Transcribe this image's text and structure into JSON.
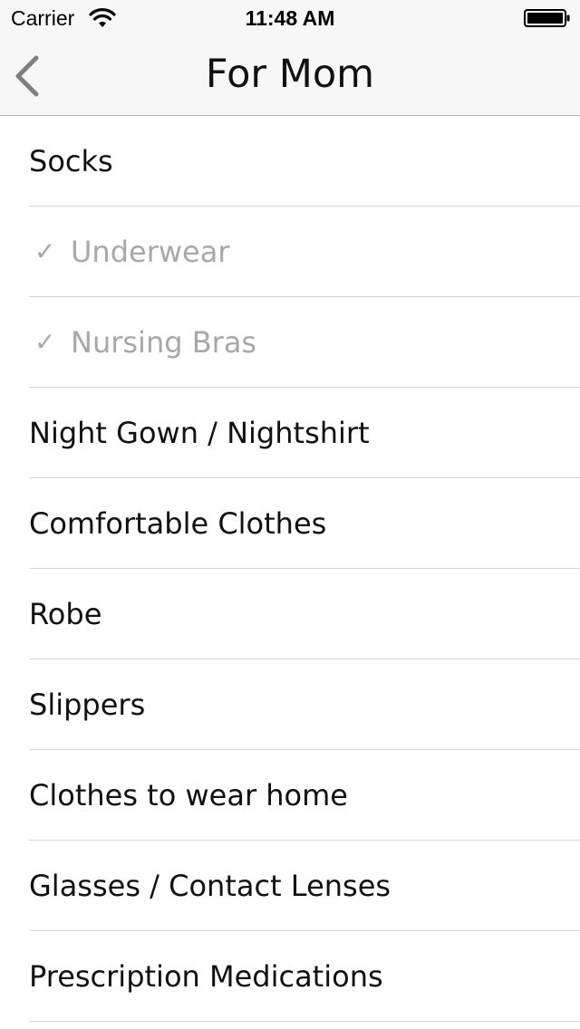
{
  "status_bar": {
    "carrier": "Carrier",
    "time": "11:48 AM",
    "wifi_icon": "wifi-icon",
    "battery_icon": "battery-icon"
  },
  "nav": {
    "title": "For Mom",
    "back_icon": "chevron-left-icon"
  },
  "items": [
    {
      "label": "Socks",
      "checked": false
    },
    {
      "label": "Underwear",
      "checked": true
    },
    {
      "label": "Nursing Bras",
      "checked": true
    },
    {
      "label": "Night Gown / Nightshirt",
      "checked": false
    },
    {
      "label": "Comfortable Clothes",
      "checked": false
    },
    {
      "label": "Robe",
      "checked": false
    },
    {
      "label": "Slippers",
      "checked": false
    },
    {
      "label": "Clothes to wear home",
      "checked": false
    },
    {
      "label": "Glasses / Contact Lenses",
      "checked": false
    },
    {
      "label": "Prescription Medications",
      "checked": false
    }
  ],
  "check_mark": "✓",
  "colors": {
    "checked_text": "#a8a8a8",
    "text": "#111111",
    "back_chevron": "#7f7f7f"
  }
}
